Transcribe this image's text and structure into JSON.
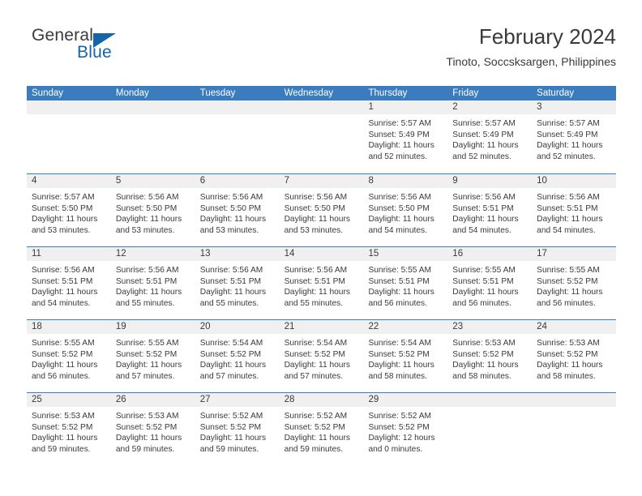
{
  "brand": {
    "name_dark": "General",
    "name_blue": "Blue",
    "accent_color": "#1464aa"
  },
  "header": {
    "title": "February 2024",
    "subtitle": "Tinoto, Soccsksargen, Philippines"
  },
  "theme": {
    "header_bar_color": "#3a7cbe",
    "day_band_color": "#f0f0f0",
    "text_color": "#3a3a3a"
  },
  "weekdays": [
    "Sunday",
    "Monday",
    "Tuesday",
    "Wednesday",
    "Thursday",
    "Friday",
    "Saturday"
  ],
  "weeks": [
    [
      {
        "day": "",
        "lines": []
      },
      {
        "day": "",
        "lines": []
      },
      {
        "day": "",
        "lines": []
      },
      {
        "day": "",
        "lines": []
      },
      {
        "day": "1",
        "lines": [
          "Sunrise: 5:57 AM",
          "Sunset: 5:49 PM",
          "Daylight: 11 hours",
          "and 52 minutes."
        ]
      },
      {
        "day": "2",
        "lines": [
          "Sunrise: 5:57 AM",
          "Sunset: 5:49 PM",
          "Daylight: 11 hours",
          "and 52 minutes."
        ]
      },
      {
        "day": "3",
        "lines": [
          "Sunrise: 5:57 AM",
          "Sunset: 5:49 PM",
          "Daylight: 11 hours",
          "and 52 minutes."
        ]
      }
    ],
    [
      {
        "day": "4",
        "lines": [
          "Sunrise: 5:57 AM",
          "Sunset: 5:50 PM",
          "Daylight: 11 hours",
          "and 53 minutes."
        ]
      },
      {
        "day": "5",
        "lines": [
          "Sunrise: 5:56 AM",
          "Sunset: 5:50 PM",
          "Daylight: 11 hours",
          "and 53 minutes."
        ]
      },
      {
        "day": "6",
        "lines": [
          "Sunrise: 5:56 AM",
          "Sunset: 5:50 PM",
          "Daylight: 11 hours",
          "and 53 minutes."
        ]
      },
      {
        "day": "7",
        "lines": [
          "Sunrise: 5:56 AM",
          "Sunset: 5:50 PM",
          "Daylight: 11 hours",
          "and 53 minutes."
        ]
      },
      {
        "day": "8",
        "lines": [
          "Sunrise: 5:56 AM",
          "Sunset: 5:50 PM",
          "Daylight: 11 hours",
          "and 54 minutes."
        ]
      },
      {
        "day": "9",
        "lines": [
          "Sunrise: 5:56 AM",
          "Sunset: 5:51 PM",
          "Daylight: 11 hours",
          "and 54 minutes."
        ]
      },
      {
        "day": "10",
        "lines": [
          "Sunrise: 5:56 AM",
          "Sunset: 5:51 PM",
          "Daylight: 11 hours",
          "and 54 minutes."
        ]
      }
    ],
    [
      {
        "day": "11",
        "lines": [
          "Sunrise: 5:56 AM",
          "Sunset: 5:51 PM",
          "Daylight: 11 hours",
          "and 54 minutes."
        ]
      },
      {
        "day": "12",
        "lines": [
          "Sunrise: 5:56 AM",
          "Sunset: 5:51 PM",
          "Daylight: 11 hours",
          "and 55 minutes."
        ]
      },
      {
        "day": "13",
        "lines": [
          "Sunrise: 5:56 AM",
          "Sunset: 5:51 PM",
          "Daylight: 11 hours",
          "and 55 minutes."
        ]
      },
      {
        "day": "14",
        "lines": [
          "Sunrise: 5:56 AM",
          "Sunset: 5:51 PM",
          "Daylight: 11 hours",
          "and 55 minutes."
        ]
      },
      {
        "day": "15",
        "lines": [
          "Sunrise: 5:55 AM",
          "Sunset: 5:51 PM",
          "Daylight: 11 hours",
          "and 56 minutes."
        ]
      },
      {
        "day": "16",
        "lines": [
          "Sunrise: 5:55 AM",
          "Sunset: 5:51 PM",
          "Daylight: 11 hours",
          "and 56 minutes."
        ]
      },
      {
        "day": "17",
        "lines": [
          "Sunrise: 5:55 AM",
          "Sunset: 5:52 PM",
          "Daylight: 11 hours",
          "and 56 minutes."
        ]
      }
    ],
    [
      {
        "day": "18",
        "lines": [
          "Sunrise: 5:55 AM",
          "Sunset: 5:52 PM",
          "Daylight: 11 hours",
          "and 56 minutes."
        ]
      },
      {
        "day": "19",
        "lines": [
          "Sunrise: 5:55 AM",
          "Sunset: 5:52 PM",
          "Daylight: 11 hours",
          "and 57 minutes."
        ]
      },
      {
        "day": "20",
        "lines": [
          "Sunrise: 5:54 AM",
          "Sunset: 5:52 PM",
          "Daylight: 11 hours",
          "and 57 minutes."
        ]
      },
      {
        "day": "21",
        "lines": [
          "Sunrise: 5:54 AM",
          "Sunset: 5:52 PM",
          "Daylight: 11 hours",
          "and 57 minutes."
        ]
      },
      {
        "day": "22",
        "lines": [
          "Sunrise: 5:54 AM",
          "Sunset: 5:52 PM",
          "Daylight: 11 hours",
          "and 58 minutes."
        ]
      },
      {
        "day": "23",
        "lines": [
          "Sunrise: 5:53 AM",
          "Sunset: 5:52 PM",
          "Daylight: 11 hours",
          "and 58 minutes."
        ]
      },
      {
        "day": "24",
        "lines": [
          "Sunrise: 5:53 AM",
          "Sunset: 5:52 PM",
          "Daylight: 11 hours",
          "and 58 minutes."
        ]
      }
    ],
    [
      {
        "day": "25",
        "lines": [
          "Sunrise: 5:53 AM",
          "Sunset: 5:52 PM",
          "Daylight: 11 hours",
          "and 59 minutes."
        ]
      },
      {
        "day": "26",
        "lines": [
          "Sunrise: 5:53 AM",
          "Sunset: 5:52 PM",
          "Daylight: 11 hours",
          "and 59 minutes."
        ]
      },
      {
        "day": "27",
        "lines": [
          "Sunrise: 5:52 AM",
          "Sunset: 5:52 PM",
          "Daylight: 11 hours",
          "and 59 minutes."
        ]
      },
      {
        "day": "28",
        "lines": [
          "Sunrise: 5:52 AM",
          "Sunset: 5:52 PM",
          "Daylight: 11 hours",
          "and 59 minutes."
        ]
      },
      {
        "day": "29",
        "lines": [
          "Sunrise: 5:52 AM",
          "Sunset: 5:52 PM",
          "Daylight: 12 hours",
          "and 0 minutes."
        ]
      },
      {
        "day": "",
        "lines": []
      },
      {
        "day": "",
        "lines": []
      }
    ]
  ]
}
